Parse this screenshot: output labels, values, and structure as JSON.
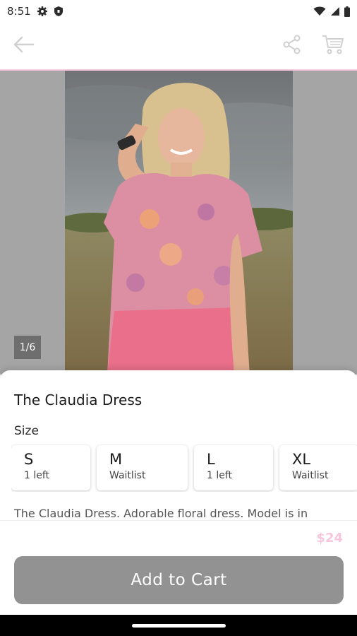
{
  "status": {
    "time": "8:51",
    "icons": [
      "gear-icon",
      "shield-icon",
      "wifi-icon",
      "cell-signal-icon",
      "battery-icon"
    ]
  },
  "app_bar": {
    "icons": [
      "back-arrow-icon",
      "share-icon",
      "cart-icon"
    ]
  },
  "gallery": {
    "counter": "1/6"
  },
  "product": {
    "title": "The Claudia Dress",
    "size_label": "Size",
    "sizes": [
      {
        "size": "S",
        "availability": "1 left"
      },
      {
        "size": "M",
        "availability": "Waitlist"
      },
      {
        "size": "L",
        "availability": "1 left"
      },
      {
        "size": "XL",
        "availability": "Waitlist"
      }
    ],
    "description": "The Claudia Dress. Adorable floral dress. Model is in"
  },
  "purchase": {
    "price": "$24",
    "add_to_cart_label": "Add to Cart"
  },
  "colors": {
    "accent_pink": "#f8c6dc",
    "button_gray": "#929292"
  }
}
